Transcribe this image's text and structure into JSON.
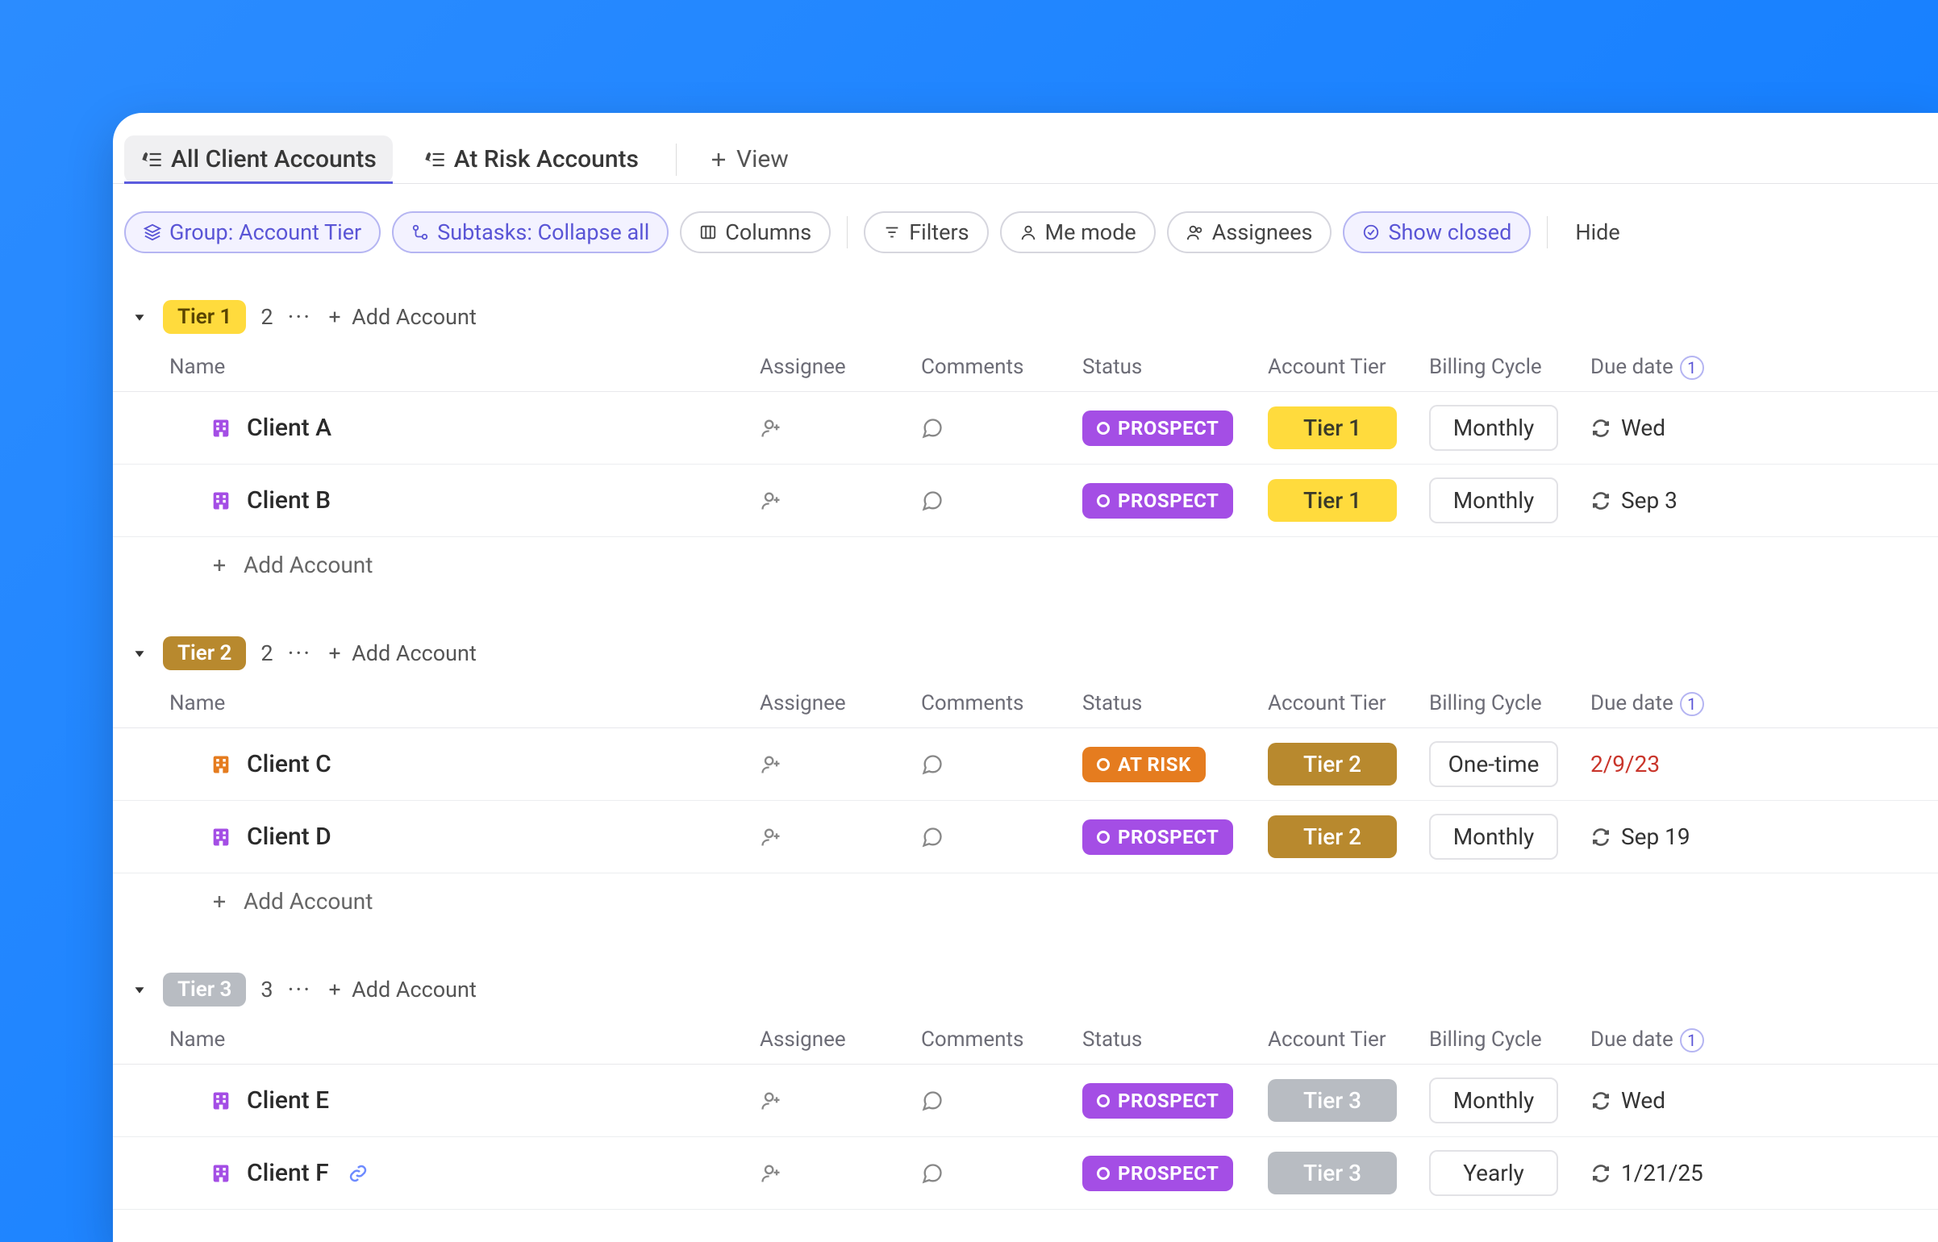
{
  "tabs": [
    {
      "label": "All Client Accounts",
      "active": true
    },
    {
      "label": "At Risk Accounts",
      "active": false
    }
  ],
  "add_view_label": "View",
  "pills": {
    "group": "Group: Account Tier",
    "subtasks": "Subtasks: Collapse all",
    "columns": "Columns",
    "filters": "Filters",
    "me_mode": "Me mode",
    "assignees": "Assignees",
    "show_closed": "Show closed",
    "hide": "Hide"
  },
  "columns": {
    "name": "Name",
    "assignee": "Assignee",
    "comments": "Comments",
    "status": "Status",
    "account_tier": "Account Tier",
    "billing_cycle": "Billing Cycle",
    "due_date": "Due date"
  },
  "due_badge": "1",
  "add_account_label": "Add Account",
  "groups": [
    {
      "tier_label": "Tier 1",
      "tier_class": "tier-1",
      "count": "2",
      "rows": [
        {
          "name": "Client A",
          "icon": "purple",
          "status": "PROSPECT",
          "status_class": "status-prospect",
          "tier": "Tier 1",
          "tier_class": "tierp-1",
          "billing": "Monthly",
          "due": "Wed",
          "recur": true,
          "overdue": false,
          "link": false
        },
        {
          "name": "Client B",
          "icon": "purple",
          "status": "PROSPECT",
          "status_class": "status-prospect",
          "tier": "Tier 1",
          "tier_class": "tierp-1",
          "billing": "Monthly",
          "due": "Sep 3",
          "recur": true,
          "overdue": false,
          "link": false
        }
      ]
    },
    {
      "tier_label": "Tier 2",
      "tier_class": "tier-2",
      "count": "2",
      "rows": [
        {
          "name": "Client C",
          "icon": "orange",
          "status": "AT RISK",
          "status_class": "status-atrisk",
          "tier": "Tier 2",
          "tier_class": "tierp-2",
          "billing": "One-time",
          "due": "2/9/23",
          "recur": false,
          "overdue": true,
          "link": false
        },
        {
          "name": "Client D",
          "icon": "purple",
          "status": "PROSPECT",
          "status_class": "status-prospect",
          "tier": "Tier 2",
          "tier_class": "tierp-2",
          "billing": "Monthly",
          "due": "Sep 19",
          "recur": true,
          "overdue": false,
          "link": false
        }
      ]
    },
    {
      "tier_label": "Tier 3",
      "tier_class": "tier-3",
      "count": "3",
      "rows": [
        {
          "name": "Client E",
          "icon": "purple",
          "status": "PROSPECT",
          "status_class": "status-prospect",
          "tier": "Tier 3",
          "tier_class": "tierp-3",
          "billing": "Monthly",
          "due": "Wed",
          "recur": true,
          "overdue": false,
          "link": false
        },
        {
          "name": "Client F",
          "icon": "purple",
          "status": "PROSPECT",
          "status_class": "status-prospect",
          "tier": "Tier 3",
          "tier_class": "tierp-3",
          "billing": "Yearly",
          "due": "1/21/25",
          "recur": true,
          "overdue": false,
          "link": true
        }
      ]
    }
  ]
}
